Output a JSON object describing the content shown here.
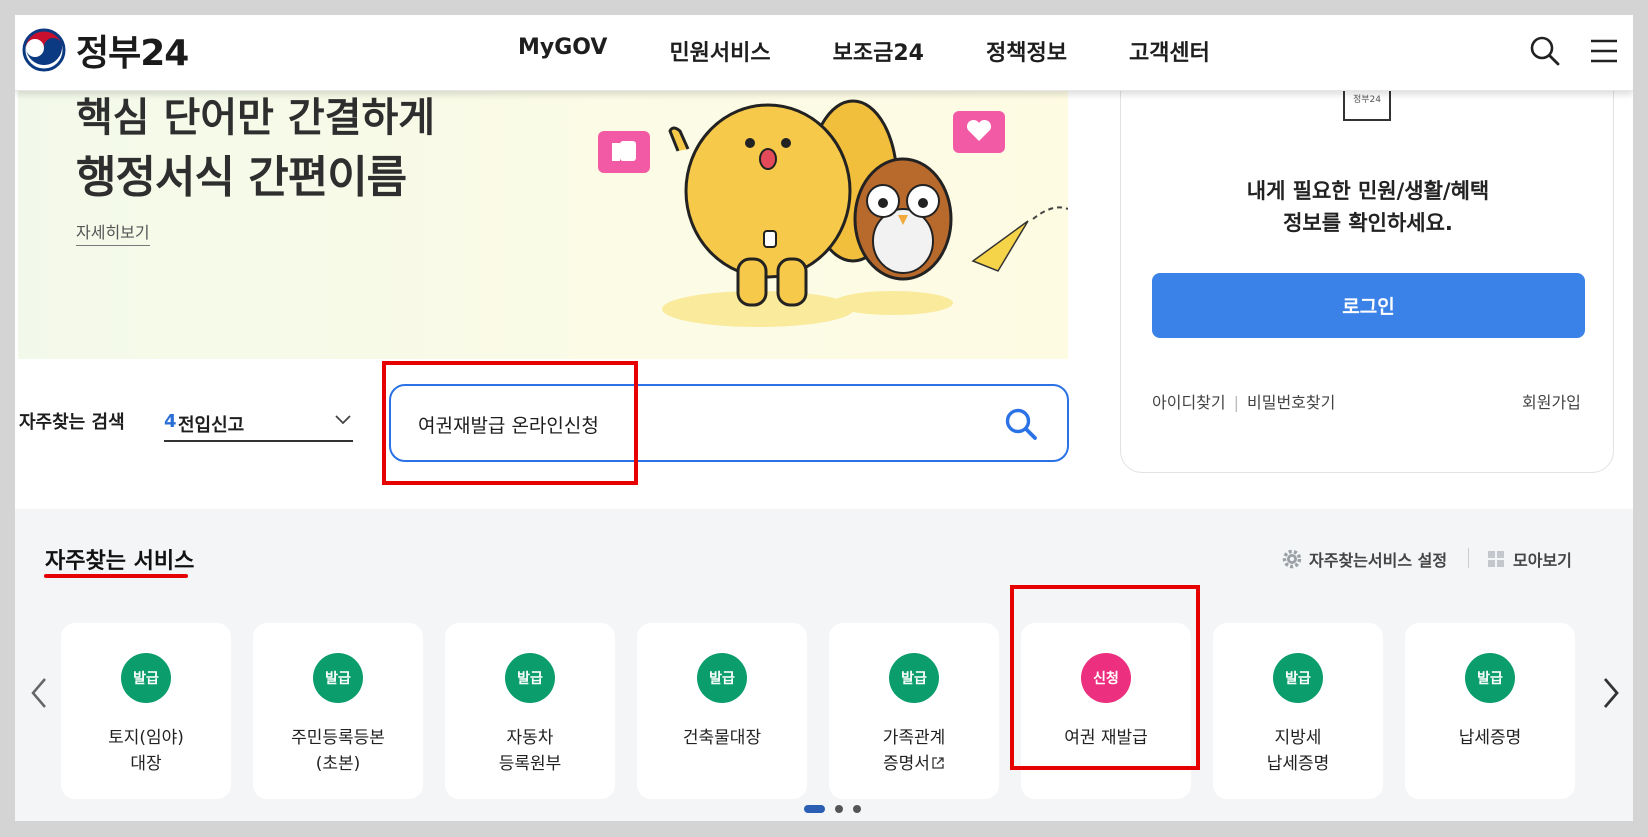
{
  "header": {
    "logo_text": "정부24",
    "nav": [
      "MyGOV",
      "민원서비스",
      "보조금24",
      "정책정보",
      "고객센터"
    ]
  },
  "banner": {
    "line1": "핵심 단어만 간결하게",
    "line2": "행정서식 간편이름",
    "more_link": "자세히보기"
  },
  "search": {
    "fav_label": "자주찾는 검색",
    "select_number": "4",
    "select_text": "전입신고",
    "input_value": "여권재발급 온라인신청"
  },
  "login_card": {
    "logo_text": "정부24",
    "message_line1": "내게 필요한 민원/생활/혜택",
    "message_line2": "정보를 확인하세요.",
    "login_button": "로그인",
    "find_id": "아이디찾기",
    "find_password": "비밀번호찾기",
    "signup": "회원가입"
  },
  "services": {
    "title": "자주찾는 서비스",
    "settings_label": "자주찾는서비스 설정",
    "view_all_label": "모아보기",
    "cards": [
      {
        "badge": "발급",
        "badge_color": "#0b9d6b",
        "line1": "토지(임야)",
        "line2": "대장"
      },
      {
        "badge": "발급",
        "badge_color": "#0b9d6b",
        "line1": "주민등록등본",
        "line2": "(초본)"
      },
      {
        "badge": "발급",
        "badge_color": "#0b9d6b",
        "line1": "자동차",
        "line2": "등록원부"
      },
      {
        "badge": "발급",
        "badge_color": "#0b9d6b",
        "line1": "건축물대장",
        "line2": ""
      },
      {
        "badge": "발급",
        "badge_color": "#0b9d6b",
        "line1": "가족관계",
        "line2": "증명서"
      },
      {
        "badge": "신청",
        "badge_color": "#ec2f7f",
        "line1": "여권 재발급",
        "line2": ""
      },
      {
        "badge": "발급",
        "badge_color": "#0b9d6b",
        "line1": "지방세",
        "line2": "납세증명"
      },
      {
        "badge": "발급",
        "badge_color": "#0b9d6b",
        "line1": "납세증명",
        "line2": ""
      }
    ]
  },
  "colors": {
    "primary_blue": "#3b82e8",
    "highlight_red": "#e60000",
    "issue_green": "#0b9d6b",
    "apply_pink": "#ec2f7f"
  }
}
